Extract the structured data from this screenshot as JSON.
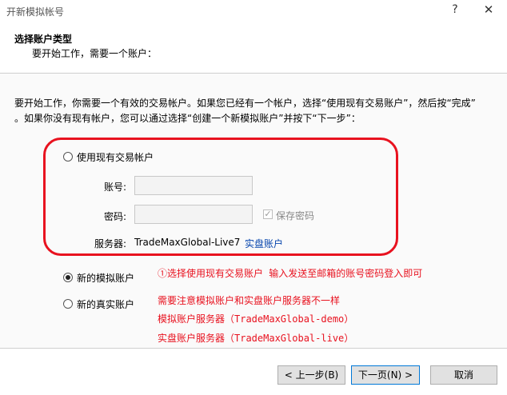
{
  "window": {
    "title": "开新模拟帐号",
    "help_label": "?",
    "close_label": "✕"
  },
  "header": {
    "title": "选择账户类型",
    "subtitle": "要开始工作，需要一个账户："
  },
  "intro": {
    "line1": "要开始工作，你需要一个有效的交易帐户。如果您已经有一个帐户，选择“使用现有交易账户”，然后按“完成”",
    "line2": "。如果你没有现有帐户，您可以通过选择“创建一个新模拟账户”并按下“下一步”："
  },
  "existing": {
    "radio_label": "使用现有交易帐户",
    "login_label": "账号:",
    "login_value": "",
    "password_label": "密码:",
    "password_value": "",
    "save_password_label": "保存密码",
    "server_label": "服务器:",
    "server_value": "TradeMaxGlobal-Live7",
    "server_link": "实盘账户"
  },
  "options": {
    "demo_label": "新的模拟账户",
    "real_label": "新的真实账户"
  },
  "notes": {
    "note1": "①选择使用现有交易账户 输入发送至邮箱的账号密码登入即可",
    "note2": "需要注意模拟账户和实盘账户服务器不一样",
    "note3": "模拟账户服务器（TradeMaxGlobal-demo）",
    "note4": "实盘账户服务器（TradeMaxGlobal-live）"
  },
  "buttons": {
    "back": "< 上一步(B)",
    "next": "下一页(N) >",
    "cancel": "取消"
  },
  "colors": {
    "annotation": "#e8121f",
    "link": "#0645ad"
  },
  "icons": {
    "radio": "radio-button-icon",
    "check": "checkmark-icon"
  }
}
